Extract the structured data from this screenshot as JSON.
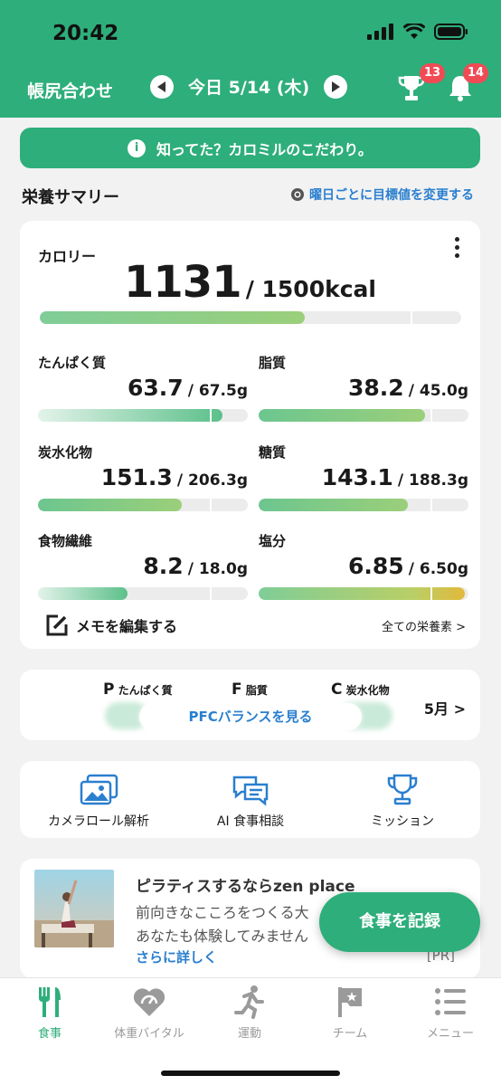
{
  "status_bar": {
    "time": "20:42"
  },
  "header": {
    "title": "帳尻合わせ",
    "date": "今日 5/14 (木)",
    "trophy_badge": "13",
    "bell_badge": "14"
  },
  "banner": {
    "text": "知ってた？カロミルのこだわり。",
    "icon": "info-icon"
  },
  "summary": {
    "title": "栄養サマリー",
    "target_link": "曜日ごとに目標値を変更する"
  },
  "calories": {
    "label": "カロリー",
    "value": "1131",
    "goal": "/ 1500kcal",
    "progress": 0.754
  },
  "nutrients": [
    {
      "label": "たんぱく質",
      "value": "63.7",
      "goal": "/ 67.5g",
      "progress": 0.943
    },
    {
      "label": "脂質",
      "value": "38.2",
      "goal": "/ 45.0g",
      "progress": 0.849
    },
    {
      "label": "炭水化物",
      "value": "151.3",
      "goal": "/ 206.3g",
      "progress": 0.733
    },
    {
      "label": "糖質",
      "value": "143.1",
      "goal": "/ 188.3g",
      "progress": 0.76
    },
    {
      "label": "食物繊維",
      "value": "8.2",
      "goal": "/ 18.0g",
      "progress": 0.456
    },
    {
      "label": "塩分",
      "value": "6.85",
      "goal": "/ 6.50g",
      "progress": 1.05
    }
  ],
  "memo": {
    "label": "メモを編集する",
    "all_nutrients": "全ての栄養素 >"
  },
  "pfc": {
    "p_letter": "P",
    "p_label": "たんぱく質",
    "f_letter": "F",
    "f_label": "脂質",
    "c_letter": "C",
    "c_label": "炭水化物",
    "button": "PFCバランスを見る",
    "month": "5月 >"
  },
  "tools": [
    {
      "label": "カメラロール解析",
      "icon": "photo-gallery-icon"
    },
    {
      "label": "AI 食事相談",
      "icon": "chat-bubbles-icon"
    },
    {
      "label": "ミッション",
      "icon": "trophy-icon"
    }
  ],
  "ad": {
    "title": "ピラティスするならzen place",
    "line1": "前向きなこころをつくる大",
    "line2": "あなたも体験してみません",
    "more": "さらに詳しく",
    "pr": "[PR]"
  },
  "fab": {
    "label": "食事を記録"
  },
  "tabs": [
    {
      "label": "食事",
      "icon": "fork-knife-icon",
      "active": true
    },
    {
      "label": "体重バイタル",
      "icon": "heart-scale-icon",
      "active": false
    },
    {
      "label": "運動",
      "icon": "runner-icon",
      "active": false
    },
    {
      "label": "チーム",
      "icon": "flag-icon",
      "active": false
    },
    {
      "label": "メニュー",
      "icon": "list-icon",
      "active": false
    }
  ],
  "colors": {
    "brand": "#2eae7b",
    "link": "#2a7fcf",
    "badge": "#f04b55",
    "over_limit": "#e2b93b"
  }
}
